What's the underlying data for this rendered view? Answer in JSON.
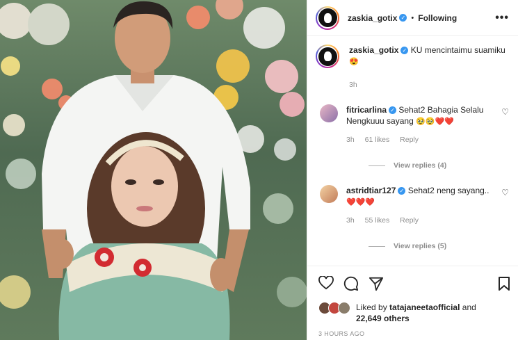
{
  "post": {
    "username": "zaskia_gotix",
    "follow_status": "Following",
    "more_icon": "more-options-icon"
  },
  "caption": {
    "username": "zaskia_gotix",
    "text": "KU mencintaimu suamiku",
    "emoji": "😍",
    "time": "3h"
  },
  "comments": [
    {
      "username": "fitricarlina",
      "text": "Sehat2 Bahagia Selalu Nengkuuu sayang",
      "emoji": "🥹🥹❤️❤️",
      "time": "3h",
      "likes": "61 likes",
      "reply": "Reply",
      "view_replies": "View replies (4)"
    },
    {
      "username": "astridtiar127",
      "text": "Sehat2 neng sayang..",
      "emoji": "❤️❤️❤️",
      "time": "3h",
      "likes": "55 likes",
      "reply": "Reply",
      "view_replies": "View replies (5)"
    }
  ],
  "actions": {
    "liked_by_prefix": "Liked by",
    "liked_by_user": "tatajaneetaofficial",
    "liked_by_and": "and",
    "liked_by_count": "22,649 others",
    "timestamp": "3 HOURS AGO"
  },
  "colors": {
    "verified": "#3897f0",
    "heart": "#ed4956",
    "muted": "#8e8e8e"
  }
}
